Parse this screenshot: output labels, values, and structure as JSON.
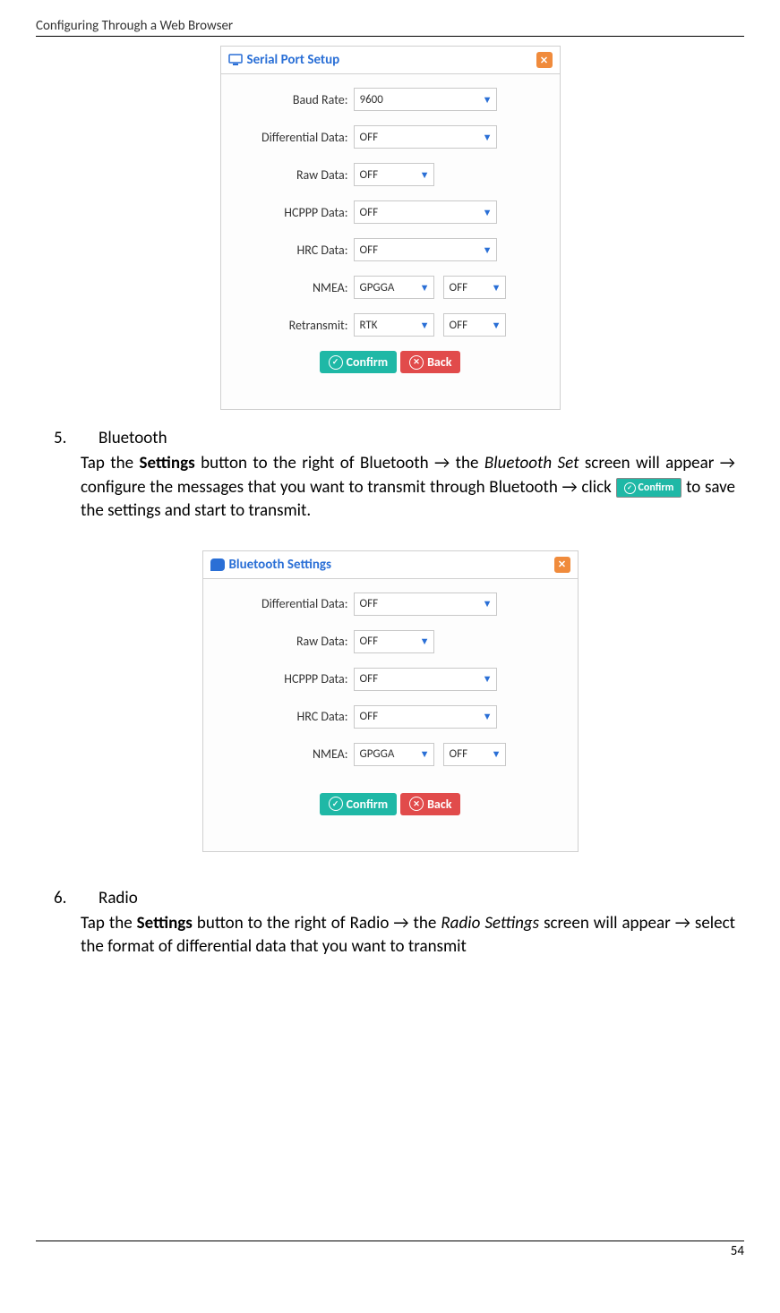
{
  "header": "Configuring Through a Web Browser",
  "page_number": "54",
  "dialog1": {
    "title": "Serial Port Setup",
    "fields": {
      "baud_rate": {
        "label": "Baud Rate:",
        "value": "9600"
      },
      "diff_data": {
        "label": "Differential Data:",
        "value": "OFF"
      },
      "raw_data": {
        "label": "Raw Data:",
        "value": "OFF"
      },
      "hcppp": {
        "label": "HCPPP Data:",
        "value": "OFF"
      },
      "hrc": {
        "label": "HRC Data:",
        "value": "OFF"
      },
      "nmea": {
        "label": "NMEA:",
        "v1": "GPGGA",
        "v2": "OFF"
      },
      "retransmit": {
        "label": "Retransmit:",
        "v1": "RTK",
        "v2": "OFF"
      }
    },
    "confirm": "Confirm",
    "back": "Back"
  },
  "section5": {
    "num": "5.",
    "title": "Bluetooth",
    "p1a": "Tap the ",
    "p1b": "Settings",
    "p1c": " button to the right of Bluetooth → the ",
    "p1d": "Bluetooth Set",
    "p1e": " screen will appear → configure the messages that you want to transmit through Bluetooth → click ",
    "confirm_btn": "Confirm",
    "p1f": " to save the settings and start to transmit."
  },
  "dialog2": {
    "title": "Bluetooth Settings",
    "fields": {
      "diff_data": {
        "label": "Differential Data:",
        "value": "OFF"
      },
      "raw_data": {
        "label": "Raw Data:",
        "value": "OFF"
      },
      "hcppp": {
        "label": "HCPPP Data:",
        "value": "OFF"
      },
      "hrc": {
        "label": "HRC Data:",
        "value": "OFF"
      },
      "nmea": {
        "label": "NMEA:",
        "v1": "GPGGA",
        "v2": "OFF"
      }
    },
    "confirm": "Confirm",
    "back": "Back"
  },
  "section6": {
    "num": "6.",
    "title": "Radio",
    "p1a": "Tap the ",
    "p1b": "Settings",
    "p1c": " button to the right of Radio → the ",
    "p1d": "Radio Settings",
    "p1e": " screen will appear → select the format of differential data that you want to transmit"
  }
}
